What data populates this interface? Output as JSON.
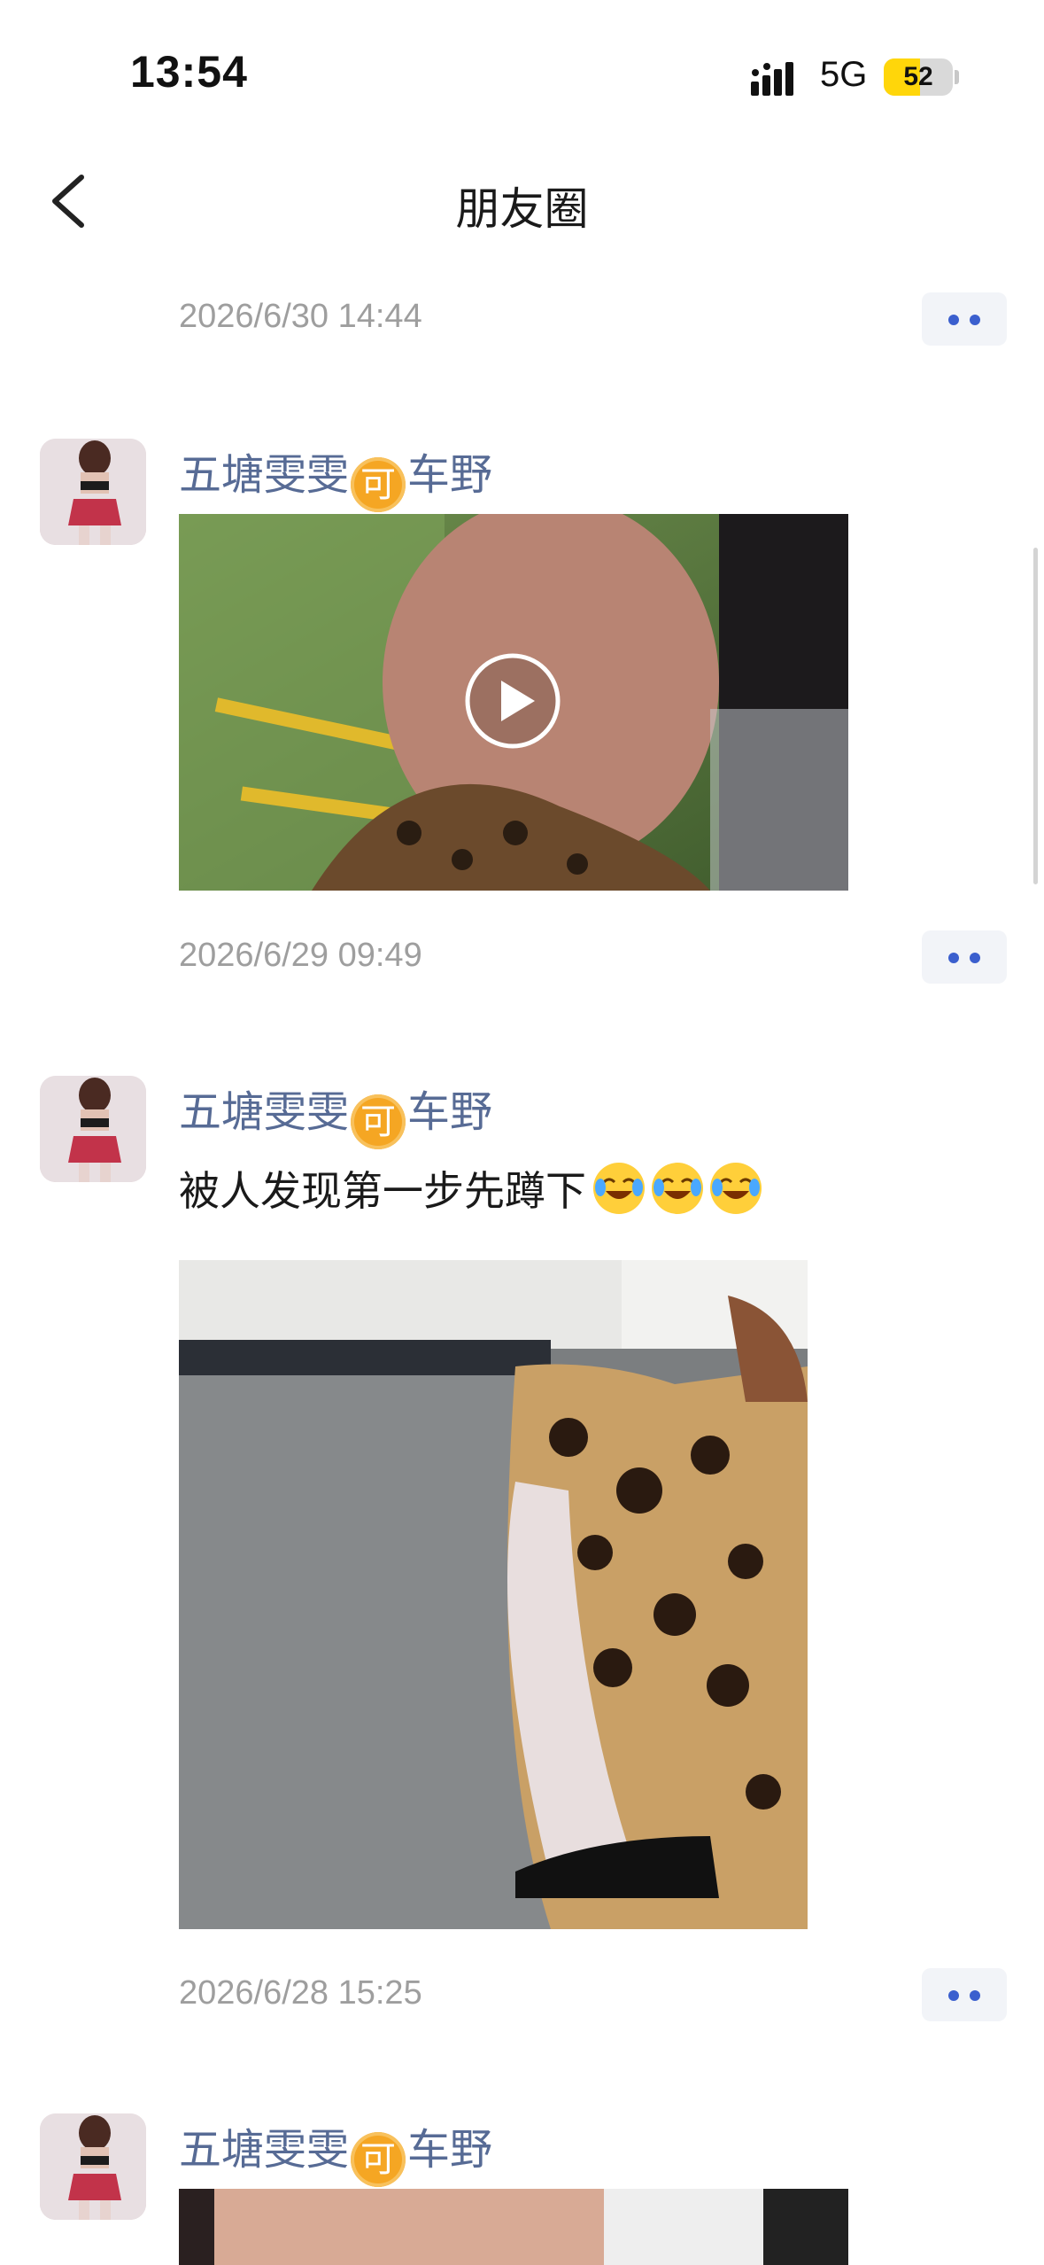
{
  "status_bar": {
    "time": "13:54",
    "network": "5G",
    "battery": "52",
    "battery_level": 0.52
  },
  "nav": {
    "title": "朋友圈"
  },
  "posts": [
    {
      "date": "2026/6/30 14:44"
    },
    {
      "author": "五塘雯雯",
      "tag": "可",
      "author_suffix": "车野",
      "media": "video",
      "date": "2026/6/29 09:49"
    },
    {
      "author": "五塘雯雯",
      "tag": "可",
      "author_suffix": "车野",
      "text": "被人发现第一步先蹲下",
      "emojis": [
        "laughing-tears",
        "laughing-tears",
        "laughing-tears"
      ],
      "media": "image",
      "date": "2026/6/28 15:25"
    },
    {
      "author": "五塘雯雯",
      "tag": "可",
      "author_suffix": "车野",
      "media": "image"
    }
  ],
  "colors": {
    "link_name": "#576b95",
    "date": "#9e9e9e",
    "accent_dot": "#3b5fce",
    "tag": "#f5a623"
  }
}
